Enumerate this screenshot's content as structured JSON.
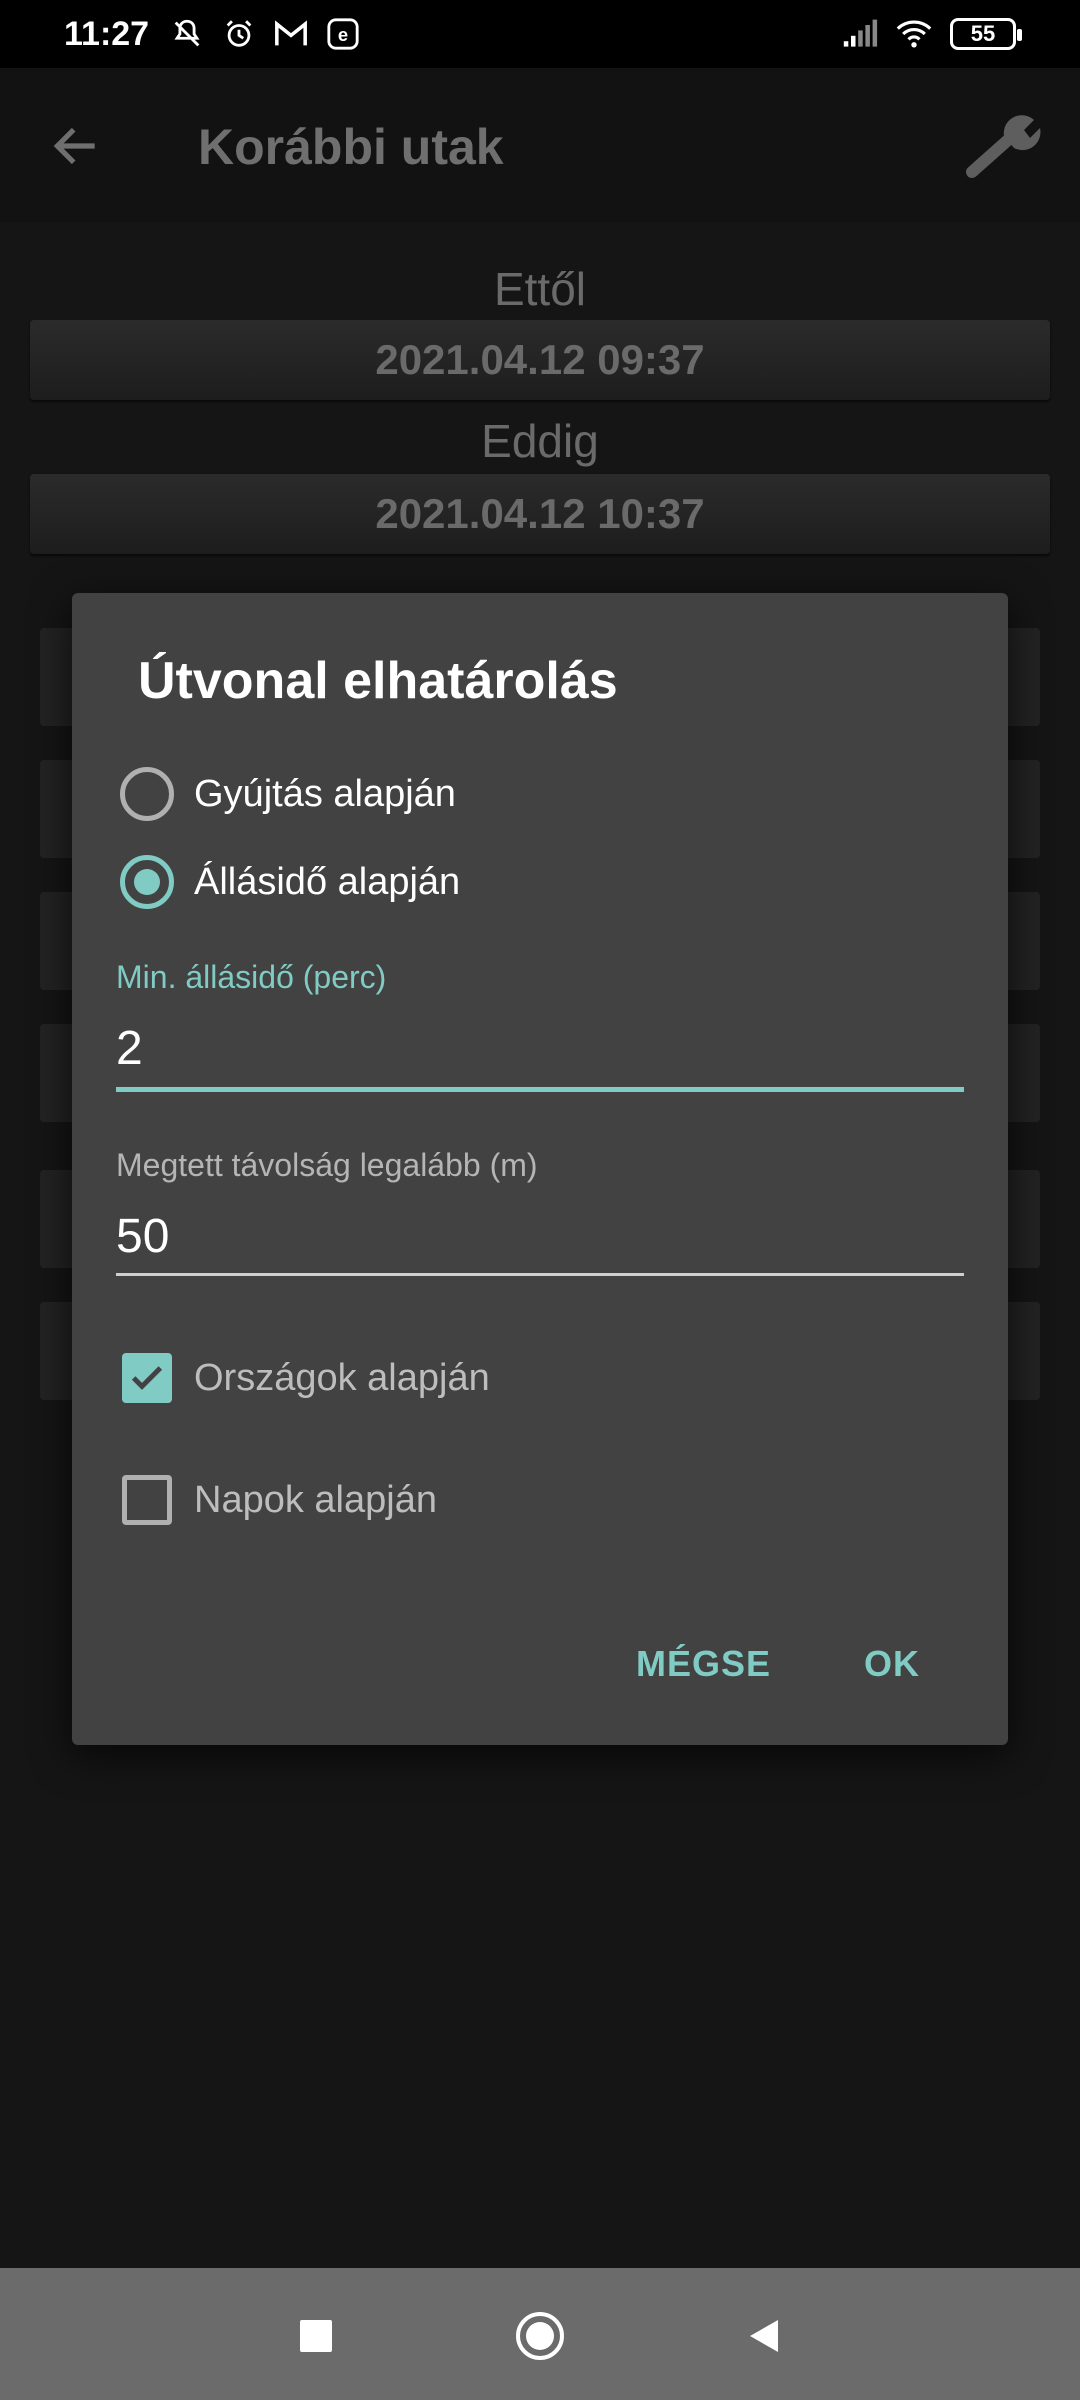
{
  "status_bar": {
    "time": "11:27",
    "left_icons": [
      "mute-icon",
      "alarm-icon",
      "gmail-icon",
      "e-app-icon"
    ],
    "right_icons": [
      "signal-icon",
      "wifi-icon"
    ],
    "battery": "55"
  },
  "app_bar": {
    "title": "Korábbi utak",
    "back_icon": "arrow-left-icon",
    "settings_icon": "wrench-icon"
  },
  "filter": {
    "from_label": "Ettől",
    "from_value": "2021.04.12 09:37",
    "to_label": "Eddig",
    "to_value": "2021.04.12 10:37"
  },
  "dialog": {
    "title": "Útvonal elhatárolás",
    "radio_options": [
      {
        "label": "Gyújtás alapján",
        "selected": false
      },
      {
        "label": "Állásidő alapján",
        "selected": true
      }
    ],
    "min_idle": {
      "label": "Min. állásidő (perc)",
      "value": "2"
    },
    "min_distance": {
      "label": "Megtett távolság legalább (m)",
      "value": "50"
    },
    "checkboxes": [
      {
        "label": "Országok alapján",
        "checked": true
      },
      {
        "label": "Napok alapján",
        "checked": false
      }
    ],
    "cancel_label": "MÉGSE",
    "ok_label": "OK"
  },
  "colors": {
    "accent": "#80cbc4",
    "dialog_bg": "#424242",
    "screen_bg": "#151515"
  }
}
